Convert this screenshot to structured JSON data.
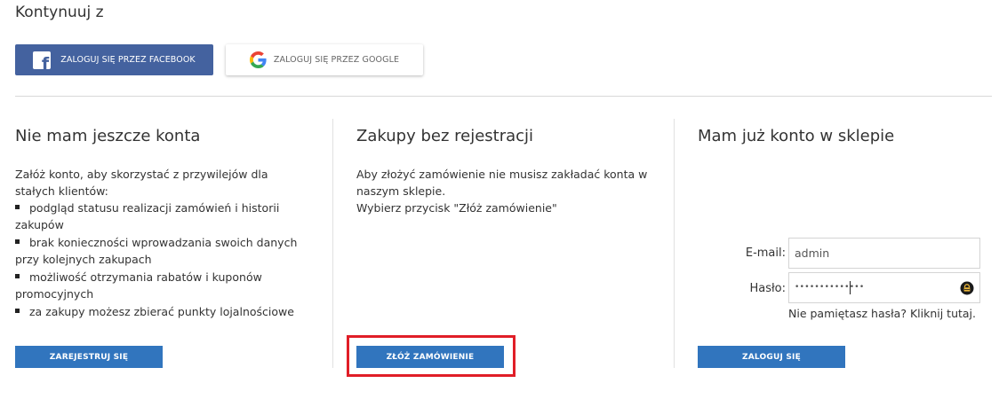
{
  "continue_section": {
    "title": "Kontynuuj z",
    "facebook_label": "ZALOGUJ SIĘ PRZEZ FACEBOOK",
    "google_label": "ZALOGUJ SIĘ PRZEZ GOOGLE"
  },
  "register": {
    "title": "Nie mam jeszcze konta",
    "intro": "Załóż konto, aby skorzystać z przywilejów dla stałych klientów:",
    "benefits": [
      "podgląd statusu realizacji zamówień i historii zakupów",
      "brak konieczności wprowadzania swoich danych przy kolejnych zakupach",
      "możliwość otrzymania rabatów i kuponów promocyjnych",
      "za zakupy możesz zbierać punkty lojalnościowe"
    ],
    "button_label": "ZAREJESTRUJ SIĘ"
  },
  "guest": {
    "title": "Zakupy bez rejestracji",
    "text_line1": "Aby złożyć zamówienie nie musisz zakładać konta w naszym sklepie.",
    "text_line2": "Wybierz przycisk \"Złóż zamówienie\"",
    "button_label": "ZŁÓŻ ZAMÓWIENIE"
  },
  "login": {
    "title": "Mam już konto w sklepie",
    "email_label": "E-mail:",
    "email_value": "admin",
    "password_label": "Hasło:",
    "password_masked": "••••••••••••••",
    "forgot_text": "Nie pamiętasz hasła? Kliknij tutaj.",
    "button_label": "ZALOGUJ SIĘ"
  },
  "colors": {
    "facebook": "#44629f",
    "primary_button": "#3175be",
    "highlight": "#e01e27"
  }
}
